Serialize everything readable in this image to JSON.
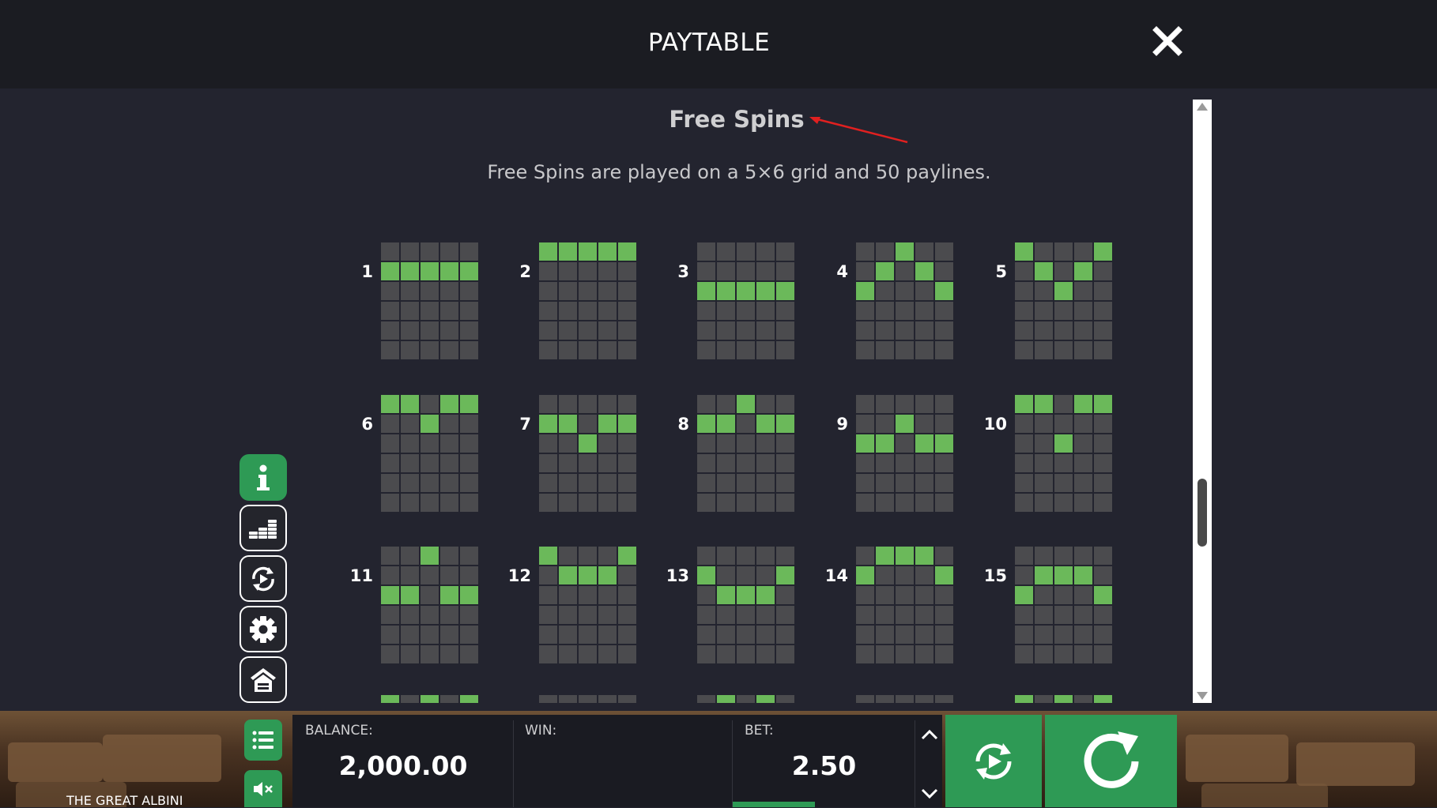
{
  "header": {
    "title": "PAYTABLE"
  },
  "section": {
    "title": "Free Spins",
    "description": "Free Spins are played on a 5×6 grid and 50 paylines."
  },
  "paylines": [
    {
      "label": "1",
      "pattern": [
        1,
        1,
        1,
        1,
        1
      ]
    },
    {
      "label": "2",
      "pattern": [
        0,
        0,
        0,
        0,
        0
      ]
    },
    {
      "label": "3",
      "pattern": [
        2,
        2,
        2,
        2,
        2
      ]
    },
    {
      "label": "4",
      "pattern": [
        2,
        1,
        0,
        1,
        2
      ]
    },
    {
      "label": "5",
      "pattern": [
        0,
        1,
        2,
        1,
        0
      ]
    },
    {
      "label": "6",
      "pattern": [
        0,
        0,
        1,
        0,
        0
      ]
    },
    {
      "label": "7",
      "pattern": [
        1,
        1,
        2,
        1,
        1
      ]
    },
    {
      "label": "8",
      "pattern": [
        1,
        1,
        0,
        1,
        1
      ]
    },
    {
      "label": "9",
      "pattern": [
        2,
        2,
        1,
        2,
        2
      ]
    },
    {
      "label": "10",
      "pattern": [
        0,
        0,
        2,
        0,
        0
      ]
    },
    {
      "label": "11",
      "pattern": [
        2,
        2,
        0,
        2,
        2
      ]
    },
    {
      "label": "12",
      "pattern": [
        0,
        1,
        1,
        1,
        0
      ]
    },
    {
      "label": "13",
      "pattern": [
        1,
        2,
        2,
        2,
        1
      ]
    },
    {
      "label": "14",
      "pattern": [
        1,
        0,
        0,
        0,
        1
      ]
    },
    {
      "label": "15",
      "pattern": [
        2,
        1,
        1,
        1,
        2
      ]
    }
  ],
  "side_menu": [
    "info-icon",
    "coins-icon",
    "autoplay-icon",
    "gear-icon",
    "home-icon"
  ],
  "bottom_bar": {
    "balance_label": "BALANCE:",
    "balance_value": "2,000.00",
    "win_label": "WIN:",
    "win_value": "",
    "bet_label": "BET:",
    "bet_value": "2.50",
    "bet_level": 0.4
  },
  "game_title": "THE GREAT ALBINI",
  "colors": {
    "accent": "#2e9a55",
    "payline_on": "#6bb95a",
    "payline_off": "#4b4b4e",
    "background": "#23242f",
    "header": "#1b1c22",
    "annotation": "#e02020"
  }
}
